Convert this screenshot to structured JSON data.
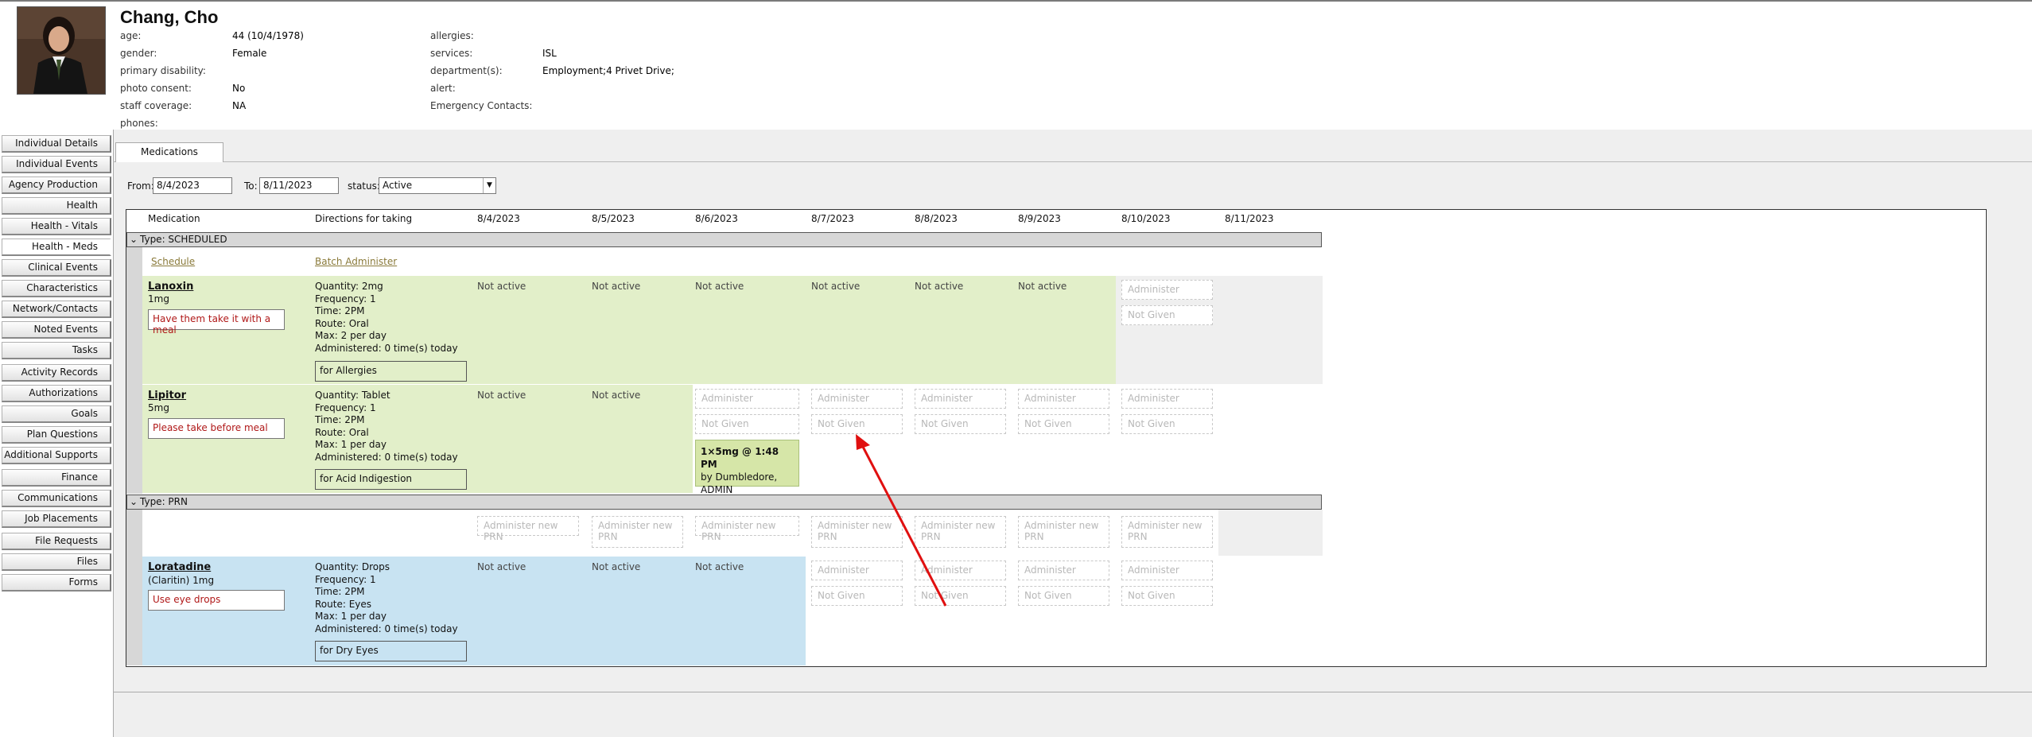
{
  "client": {
    "name": "Chang, Cho",
    "fields_left": [
      {
        "label": "age:",
        "value": "44 (10/4/1978)"
      },
      {
        "label": "gender:",
        "value": "Female"
      },
      {
        "label": "primary disability:",
        "value": ""
      },
      {
        "label": "photo consent:",
        "value": "No"
      },
      {
        "label": "staff coverage:",
        "value": "NA"
      },
      {
        "label": "phones:",
        "value": ""
      }
    ],
    "fields_right": [
      {
        "label": "allergies:",
        "value": ""
      },
      {
        "label": "services:",
        "value": "ISL"
      },
      {
        "label": "department(s):",
        "value": "Employment;4 Privet Drive;"
      },
      {
        "label": "alert:",
        "value": ""
      },
      {
        "label": "Emergency Contacts:",
        "value": ""
      }
    ]
  },
  "sidebar": {
    "items": [
      {
        "label": "Individual Details"
      },
      {
        "label": "Individual Events"
      },
      {
        "label": "Agency Production"
      },
      {
        "label": "Health"
      },
      {
        "label": "Health - Vitals"
      },
      {
        "label": "Health - Meds",
        "active": true
      },
      {
        "label": "Clinical Events"
      },
      {
        "label": "Characteristics"
      },
      {
        "label": "Network/Contacts"
      },
      {
        "label": "Noted Events"
      },
      {
        "label": "Tasks"
      },
      {
        "label": "Activity Records"
      },
      {
        "label": "Authorizations"
      },
      {
        "label": "Goals"
      },
      {
        "label": "Plan Questions"
      },
      {
        "label": "Additional Supports"
      },
      {
        "label": "Finance"
      },
      {
        "label": "Communications"
      },
      {
        "label": "Job Placements"
      },
      {
        "label": "File Requests"
      },
      {
        "label": "Files"
      },
      {
        "label": "Forms"
      }
    ]
  },
  "tabs": [
    {
      "label": "Medications"
    }
  ],
  "filters": {
    "from_label": "From:",
    "from_value": "8/4/2023",
    "to_label": "To:",
    "to_value": "8/11/2023",
    "status_label": "status:",
    "status_value": "Active"
  },
  "grid": {
    "headers": {
      "medication": "Medication",
      "directions": "Directions for taking",
      "dates": [
        "8/4/2023",
        "8/5/2023",
        "8/6/2023",
        "8/7/2023",
        "8/8/2023",
        "8/9/2023",
        "8/10/2023",
        "8/11/2023"
      ]
    },
    "type_scheduled": "Type: SCHEDULED",
    "type_prn": "Type: PRN",
    "schedule_link": "Schedule",
    "batch_link": "Batch Administer",
    "not_active": "Not active",
    "administer": "Administer",
    "not_given": "Not Given",
    "administer_new_prn": "Administer new PRN",
    "meds": [
      {
        "name": "Lanoxin",
        "dose": "1mg",
        "note": "Have them take it with a meal",
        "directions": [
          "Quantity: 2mg",
          "Frequency: 1",
          "Time: 2PM",
          "Route: Oral",
          "Max: 2 per day",
          "Administered: 0 time(s) today"
        ],
        "reason": "for Allergies"
      },
      {
        "name": "Lipitor",
        "dose": "5mg",
        "note": "Please take before meal",
        "directions": [
          "Quantity: Tablet",
          "Frequency: 1",
          "Time: 2PM",
          "Route: Oral",
          "Max: 1 per day",
          "Administered: 0 time(s) today"
        ],
        "reason": "for Acid Indigestion",
        "administration": {
          "line1": "1×5mg @ 1:48 PM",
          "line2": "by Dumbledore,",
          "line3": "ADMIN"
        }
      },
      {
        "name": "Loratadine",
        "dose": "(Claritin) 1mg",
        "note": "Use eye drops",
        "directions": [
          "Quantity: Drops",
          "Frequency: 1",
          "Time: 2PM",
          "Route: Eyes",
          "Max: 1 per day",
          "Administered: 0 time(s) today"
        ],
        "reason": "for Dry Eyes"
      }
    ]
  },
  "colors": {
    "scheduled_row": "#e2efc9",
    "prn_row": "#c8e3f2",
    "arrow": "#e01010",
    "note_text": "#b01818"
  }
}
